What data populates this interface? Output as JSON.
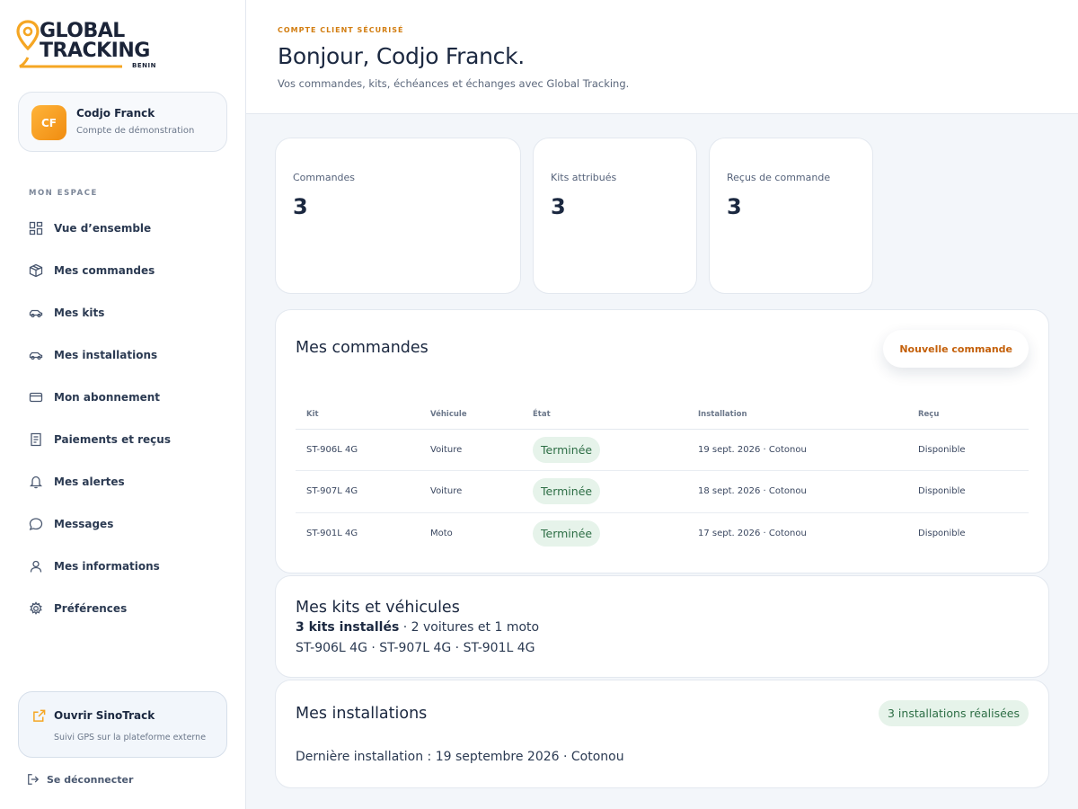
{
  "brand": {
    "line1": "GLOBAL",
    "line2": "TRACKING",
    "line3": "BENIN"
  },
  "user": {
    "initials": "CF",
    "name": "Codjo Franck",
    "subtitle": "Compte de démonstration"
  },
  "sidebar": {
    "section_label": "MON ESPACE",
    "items": [
      {
        "label": "Vue d’ensemble",
        "icon": "grid-icon"
      },
      {
        "label": "Mes commandes",
        "icon": "package-icon"
      },
      {
        "label": "Mes kits",
        "icon": "car-icon"
      },
      {
        "label": "Mes installations",
        "icon": "car-icon"
      },
      {
        "label": "Mon abonnement",
        "icon": "credit-card-icon"
      },
      {
        "label": "Paiements et reçus",
        "icon": "receipt-icon"
      },
      {
        "label": "Mes alertes",
        "icon": "bell-icon"
      },
      {
        "label": "Messages",
        "icon": "message-icon"
      },
      {
        "label": "Mes informations",
        "icon": "user-icon"
      },
      {
        "label": "Préférences",
        "icon": "gear-icon"
      }
    ],
    "sinotrack": {
      "title": "Ouvrir SinoTrack",
      "subtitle": "Suivi GPS sur la plateforme externe"
    },
    "logout": "Se déconnecter"
  },
  "header": {
    "eyebrow": "COMPTE CLIENT SÉCURISÉ",
    "greeting": "Bonjour, Codjo Franck.",
    "subtitle": "Vos commandes, kits, échéances et échanges avec Global Tracking."
  },
  "stats": [
    {
      "label": "Commandes",
      "value": "3"
    },
    {
      "label": "Kits attribués",
      "value": "3"
    },
    {
      "label": "Reçus de commande",
      "value": "3"
    }
  ],
  "orders": {
    "title": "Mes commandes",
    "new_button": "Nouvelle commande",
    "columns": [
      "Kit",
      "Véhicule",
      "État",
      "Installation",
      "Reçu"
    ],
    "rows": [
      {
        "kit": "ST-906L 4G",
        "vehicle": "Voiture",
        "state": "Terminée",
        "installation": "19 sept. 2026 · Cotonou",
        "receipt": "Disponible"
      },
      {
        "kit": "ST-907L 4G",
        "vehicle": "Voiture",
        "state": "Terminée",
        "installation": "18 sept. 2026 · Cotonou",
        "receipt": "Disponible"
      },
      {
        "kit": "ST-901L 4G",
        "vehicle": "Moto",
        "state": "Terminée",
        "installation": "17 sept. 2026 · Cotonou",
        "receipt": "Disponible"
      }
    ]
  },
  "kits": {
    "title": "Mes kits et véhicules",
    "summary_bold": "3 kits installés",
    "summary_rest": " · 2 voitures et 1 moto",
    "list": "ST-906L 4G · ST-907L 4G · ST-901L 4G"
  },
  "installations": {
    "title": "Mes installations",
    "badge": "3 installations réalisées",
    "last": "Dernière installation : 19 septembre 2026 · Cotonou"
  },
  "colors": {
    "accent": "#f5a623",
    "accent_text": "#c4600a",
    "success_bg": "#e6f3ea",
    "success_text": "#2d6e45",
    "navy": "#1b2840"
  }
}
